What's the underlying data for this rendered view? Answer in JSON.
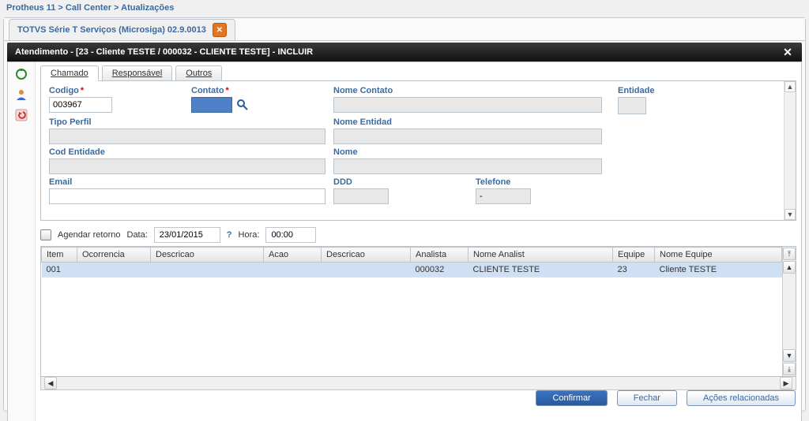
{
  "breadcrumb": {
    "p1": "Protheus 11",
    "p2": "Call Center",
    "p3": "Atualizações",
    "sep": ">"
  },
  "outerTab": {
    "label": "TOTVS Série T Serviços (Microsiga) 02.9.0013"
  },
  "titlebar": {
    "text": "Atendimento - [23 - Cliente TESTE / 000032 - CLIENTE TESTE] - INCLUIR"
  },
  "tabs": {
    "chamado": "Chamado",
    "responsavel": "Responsável",
    "outros": "Outros"
  },
  "labels": {
    "codigo": "Codigo",
    "contato": "Contato",
    "nomeContato": "Nome Contato",
    "entidade": "Entidade",
    "tipoPerfil": "Tipo Perfil",
    "nomeEntidad": "Nome Entidad",
    "codEntidade": "Cod Entidade",
    "nome": "Nome",
    "email": "Email",
    "ddd": "DDD",
    "telefone": "Telefone",
    "agendar": "Agendar retorno",
    "data": "Data:",
    "hora": "Hora:"
  },
  "values": {
    "codigo": "003967",
    "data": "23/01/2015",
    "hora": "00:00",
    "telefone": "-"
  },
  "cols": {
    "item": "Item",
    "ocorrencia": "Ocorrencia",
    "descricao1": "Descricao",
    "acao": "Acao",
    "descricao2": "Descricao",
    "analista": "Analista",
    "nomeAnalist": "Nome Analist",
    "equipe": "Equipe",
    "nomeEquipe": "Nome Equipe"
  },
  "row": {
    "item": "001",
    "ocorrencia": "",
    "descricao1": "",
    "acao": "",
    "descricao2": "",
    "analista": "000032",
    "nomeAnalist": "CLIENTE TESTE",
    "equipe": "23",
    "nomeEquipe": "Cliente TESTE"
  },
  "buttons": {
    "confirm": "Confirmar",
    "close": "Fechar",
    "related": "Ações relacionadas"
  }
}
